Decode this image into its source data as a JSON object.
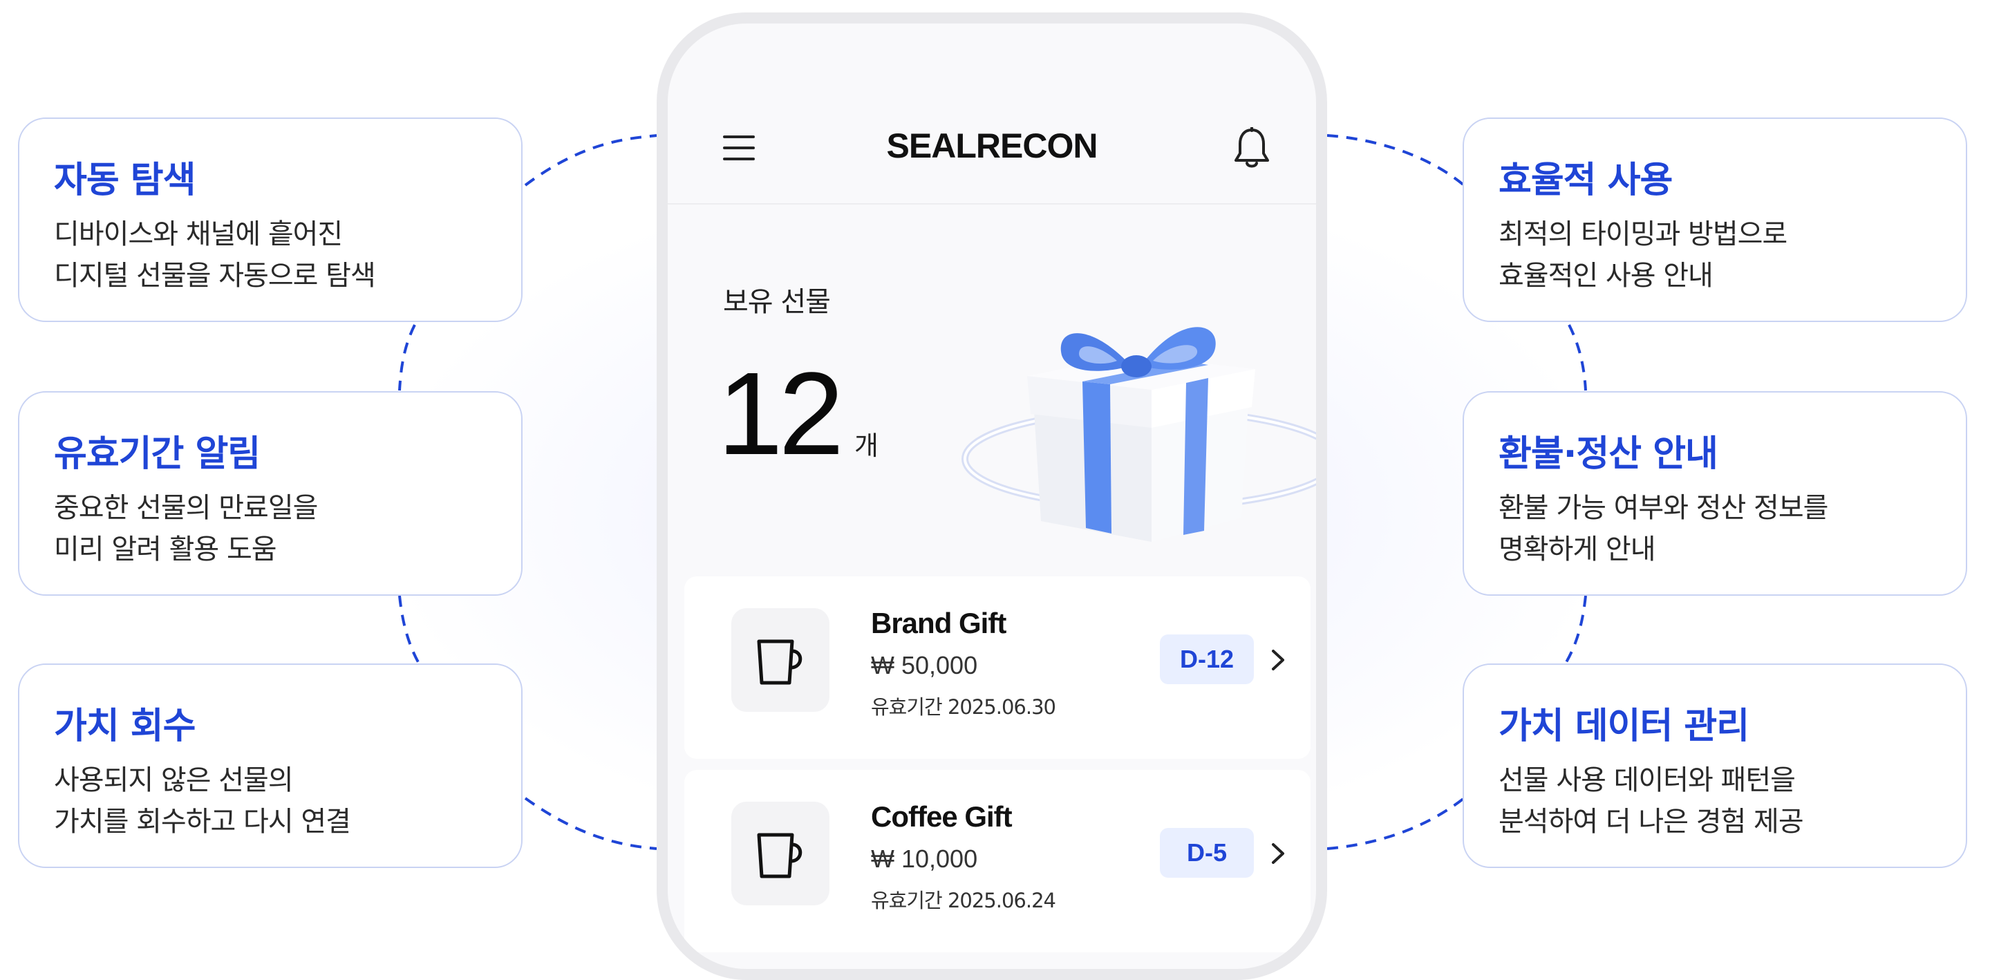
{
  "features": {
    "left": [
      {
        "title": "자동 탐색",
        "lines": [
          "디바이스와 채널에 흩어진",
          "디지털 선물을 자동으로 탐색"
        ]
      },
      {
        "title": "유효기간 알림",
        "lines": [
          "중요한 선물의 만료일을",
          "미리 알려 활용 도움"
        ]
      },
      {
        "title": "가치 회수",
        "lines": [
          "사용되지 않은 선물의",
          "가치를 회수하고 다시 연결"
        ]
      }
    ],
    "right": [
      {
        "title": "효율적 사용",
        "lines": [
          "최적의 타이밍과 방법으로",
          "효율적인 사용 안내"
        ]
      },
      {
        "title": "환불·정산 안내",
        "lines": [
          "환불 가능 여부와 정산 정보를",
          "명확하게 안내"
        ]
      },
      {
        "title": "가치 데이터 관리",
        "lines": [
          "선물 사용 데이터와 패턴을",
          "분석하여 더 나은 경험 제공"
        ]
      }
    ]
  },
  "phone": {
    "app_title": "SEALRECON",
    "holdings_label": "보유 선물",
    "holdings_count": "12",
    "holdings_unit": "개",
    "gifts": [
      {
        "name": "Brand Gift",
        "price": "₩ 50,000",
        "expiry": "유효기간 2025.06.30",
        "dday": "D-12"
      },
      {
        "name": "Coffee Gift",
        "price": "₩ 10,000",
        "expiry": "유효기간 2025.06.24",
        "dday": "D-5"
      }
    ]
  },
  "colors": {
    "accent": "#1f45d6",
    "card_border": "#c9d3f3",
    "badge_bg": "#e9efff",
    "ribbon": "#5b8cf0"
  },
  "icons": [
    "menu-icon",
    "bell-icon",
    "cup-icon",
    "chevron-right-icon",
    "gift-box-illustration"
  ]
}
